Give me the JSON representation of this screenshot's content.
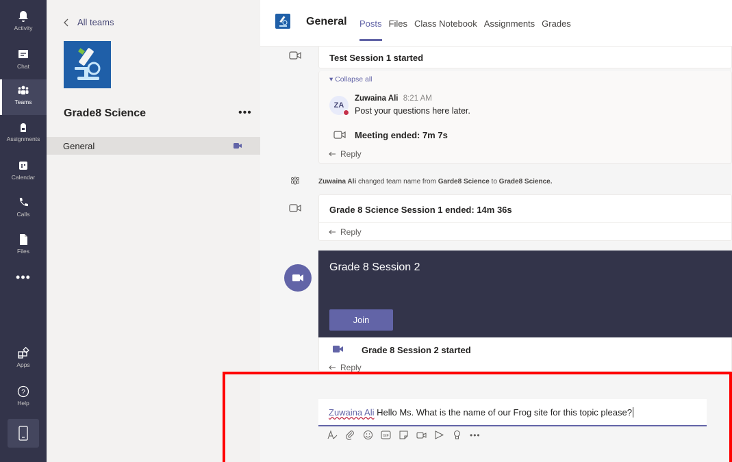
{
  "rail": {
    "items": [
      {
        "label": "Activity",
        "icon": "bell-icon"
      },
      {
        "label": "Chat",
        "icon": "chat-icon"
      },
      {
        "label": "Teams",
        "icon": "teams-icon"
      },
      {
        "label": "Assignments",
        "icon": "assignments-icon"
      },
      {
        "label": "Calendar",
        "icon": "calendar-icon"
      },
      {
        "label": "Calls",
        "icon": "phone-icon"
      },
      {
        "label": "Files",
        "icon": "file-icon"
      }
    ],
    "more": "•••",
    "apps": "Apps",
    "help": "Help"
  },
  "team_panel": {
    "back_label": "All teams",
    "team_name": "Grade8 Science",
    "more": "•••",
    "channel": "General"
  },
  "header": {
    "channel_title": "General",
    "tabs": [
      "Posts",
      "Files",
      "Class Notebook",
      "Assignments",
      "Grades"
    ]
  },
  "feed": {
    "session1_started": "Test Session 1 started",
    "collapse_all": "Collapse all",
    "reply_author": "Zuwaina Ali",
    "reply_time": "8:21 AM",
    "reply_avatar": "ZA",
    "reply_text": "Post your questions here later.",
    "meeting_ended": "Meeting ended: 7m 7s",
    "reply_label": "Reply",
    "rename_actor": "Zuwaina Ali",
    "rename_mid": "changed team name from",
    "rename_from": "Garde8 Science",
    "rename_to_word": "to",
    "rename_to": "Grade8 Science.",
    "grade8_ended": "Grade 8 Science Session 1 ended: 14m 36s",
    "session2_title": "Grade 8 Session 2",
    "join_label": "Join",
    "session2_started": "Grade 8 Session 2 started"
  },
  "compose": {
    "mention": "Zuwaina Ali",
    "text": " Hello Ms. What is the name of our Frog site for this topic please?"
  },
  "colors": {
    "rail_bg": "#33344a",
    "accent": "#6264a7",
    "highlight_box": "#ff0000",
    "presence_busy": "#c4314b"
  }
}
